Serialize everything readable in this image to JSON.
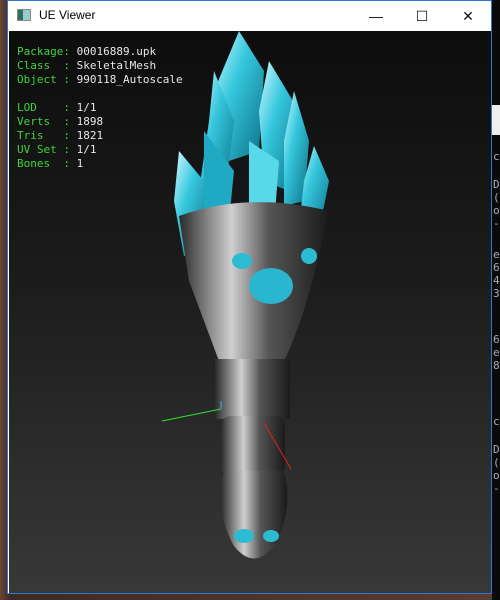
{
  "window": {
    "title": "UE Viewer",
    "minimize": "—",
    "maximize": "☐",
    "close": "✕"
  },
  "info": [
    {
      "key": "Package:",
      "value": "00016889.upk"
    },
    {
      "key": "Class  :",
      "value": "SkeletalMesh"
    },
    {
      "key": "Object :",
      "value": "990118_Autoscale"
    },
    {
      "key": "",
      "value": ""
    },
    {
      "key": "LOD    :",
      "value": "1/1"
    },
    {
      "key": "Verts  :",
      "value": "1898"
    },
    {
      "key": "Tris   :",
      "value": "1821"
    },
    {
      "key": "UV Set :",
      "value": "1/1"
    },
    {
      "key": "Bones  :",
      "value": "1"
    }
  ],
  "background_window_fragments": [
    "c",
    "D\n(\no\n-",
    "e\n6\n4\n3",
    "6\ne\n8",
    "c",
    "D\n(\no\n-"
  ],
  "colors": {
    "accent": "#2b78d6",
    "label": "#3fd43f",
    "crystal": "#2fc6dc"
  }
}
